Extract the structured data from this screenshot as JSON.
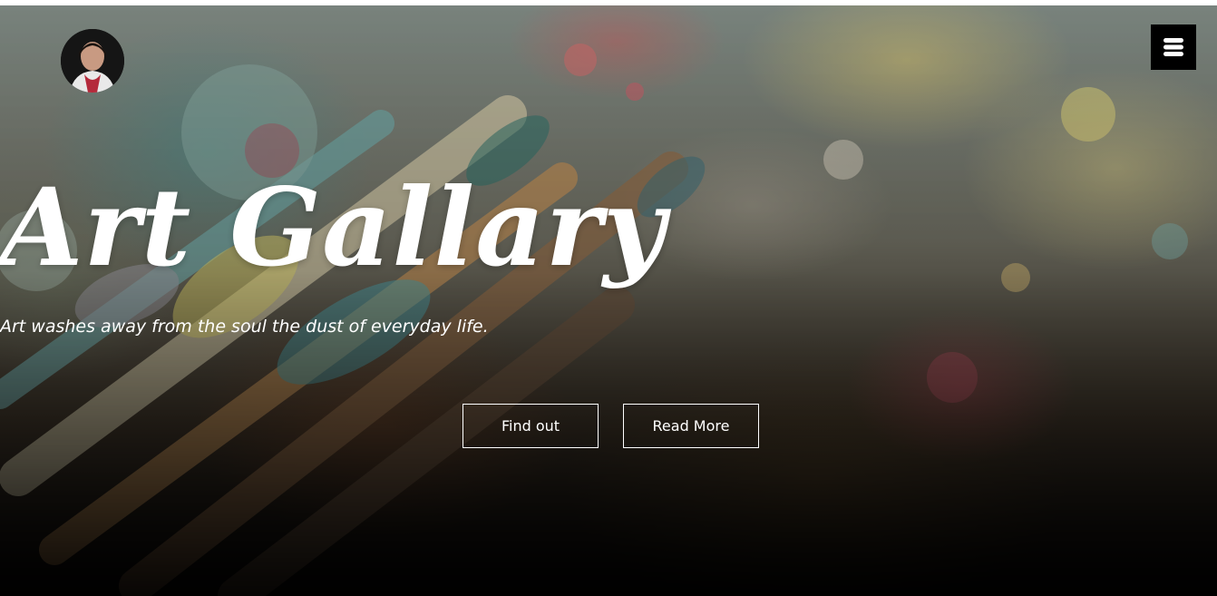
{
  "hero": {
    "title": "Art Gallary",
    "subtitle": "Art washes away from the soul the dust of everyday life."
  },
  "buttons": {
    "find_out": "Find out",
    "read_more": "Read More"
  },
  "icons": {
    "avatar": "profile-avatar",
    "menu": "hamburger-menu-icon"
  },
  "colors": {
    "text": "#ffffff",
    "menu_bg": "#000000",
    "button_border": "#ffffff"
  }
}
